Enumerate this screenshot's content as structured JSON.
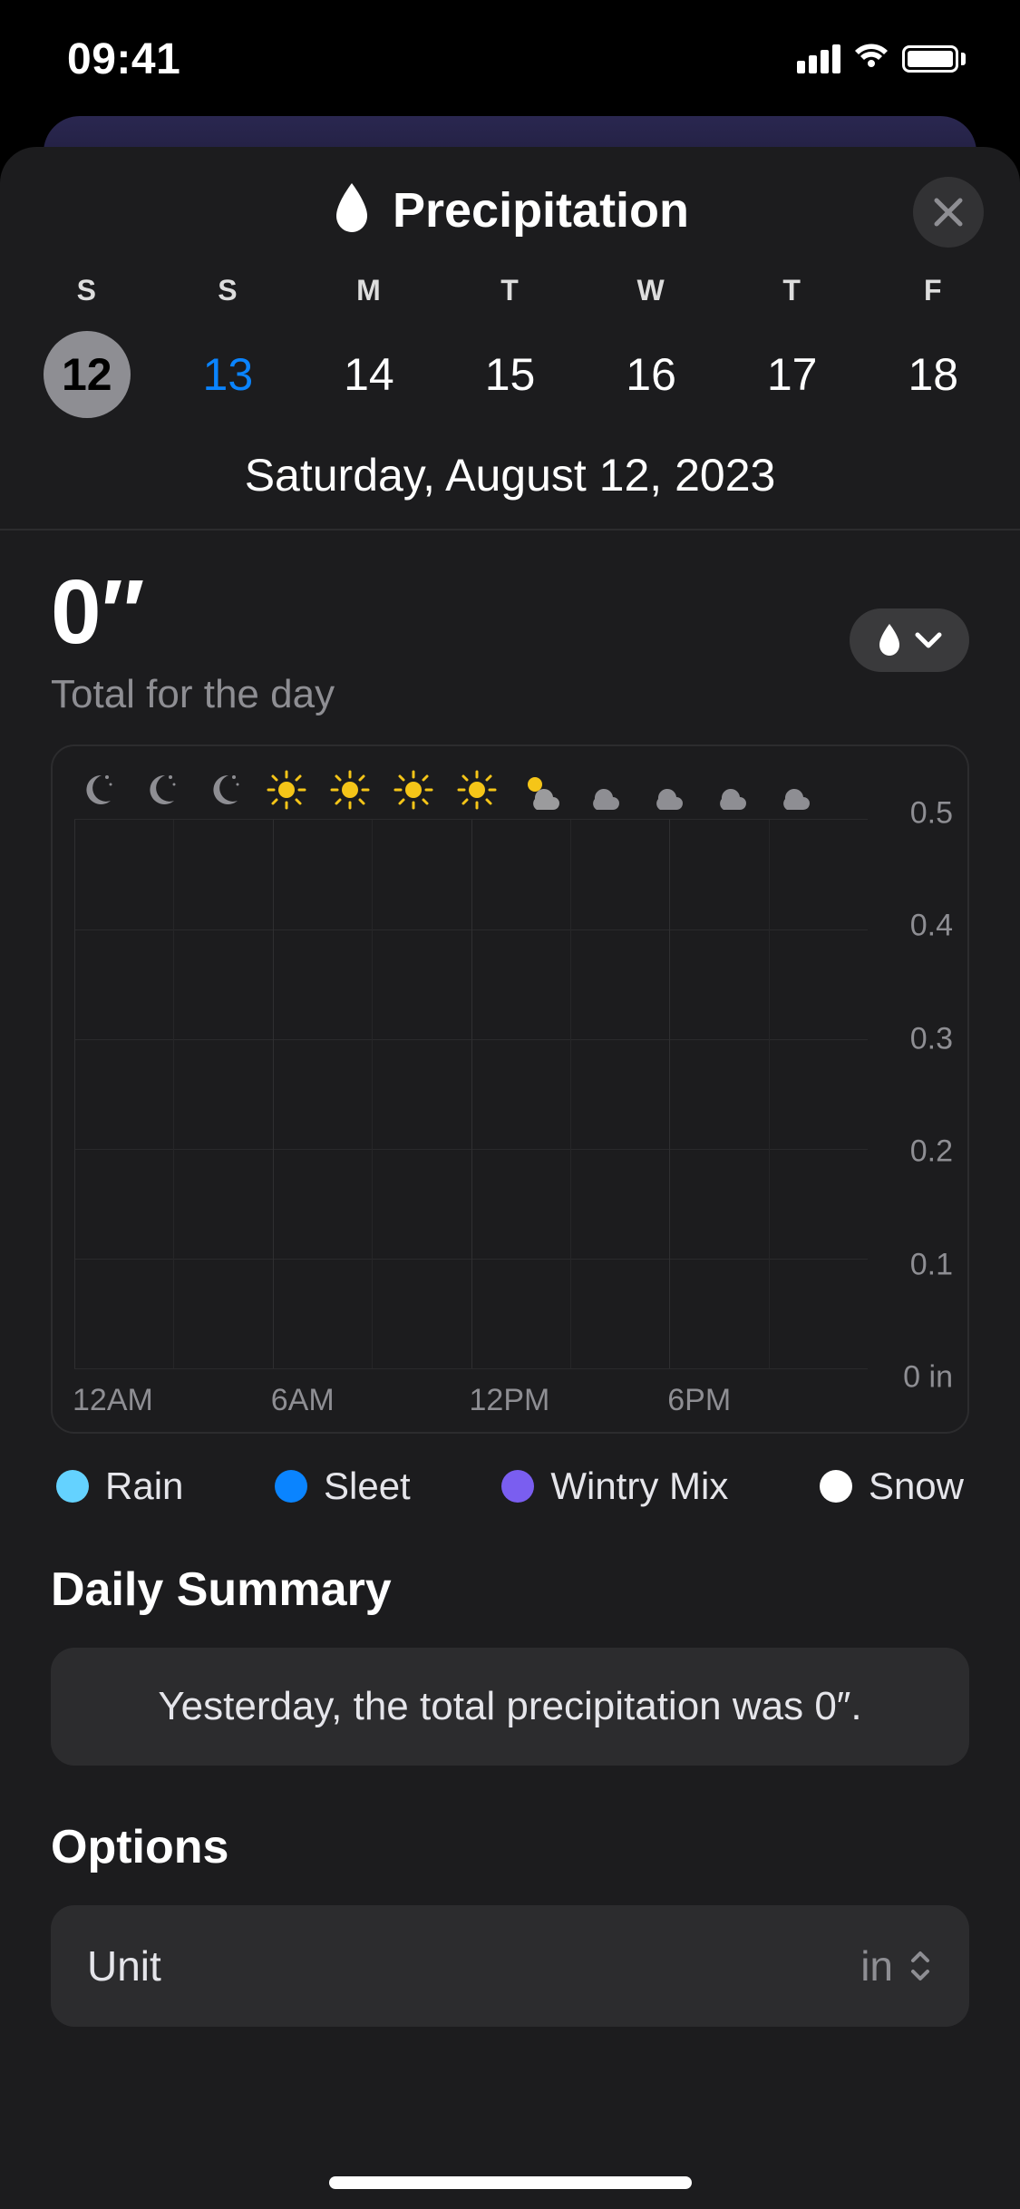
{
  "status": {
    "time": "09:41"
  },
  "header": {
    "title": "Precipitation"
  },
  "days": {
    "dows": [
      "S",
      "S",
      "M",
      "T",
      "W",
      "T",
      "F"
    ],
    "nums": [
      "12",
      "13",
      "14",
      "15",
      "16",
      "17",
      "18"
    ],
    "selected_index": 0,
    "today_index": 1,
    "full_date": "Saturday, August 12, 2023"
  },
  "total": {
    "value": "0″",
    "label": "Total for the day"
  },
  "legend": {
    "items": [
      {
        "label": "Rain",
        "color": "#64d2ff"
      },
      {
        "label": "Sleet",
        "color": "#0a84ff"
      },
      {
        "label": "Wintry Mix",
        "color": "#7a5ef0"
      },
      {
        "label": "Snow",
        "color": "#ffffff"
      }
    ]
  },
  "summary": {
    "title": "Daily Summary",
    "text": "Yesterday, the total precipitation was 0″."
  },
  "options": {
    "title": "Options",
    "unit_label": "Unit",
    "unit_value": "in"
  },
  "chart_data": {
    "type": "bar",
    "title": "Hourly precipitation",
    "x_hours": [
      0,
      1,
      2,
      3,
      4,
      5,
      6,
      7,
      8,
      9,
      10,
      11,
      12,
      13,
      14,
      15,
      16,
      17,
      18,
      19,
      20,
      21,
      22,
      23
    ],
    "series": [
      {
        "name": "Rain",
        "values": [
          0,
          0,
          0,
          0,
          0,
          0,
          0,
          0,
          0,
          0,
          0,
          0,
          0,
          0,
          0,
          0,
          0,
          0,
          0,
          0,
          0,
          0,
          0,
          0
        ]
      },
      {
        "name": "Sleet",
        "values": [
          0,
          0,
          0,
          0,
          0,
          0,
          0,
          0,
          0,
          0,
          0,
          0,
          0,
          0,
          0,
          0,
          0,
          0,
          0,
          0,
          0,
          0,
          0,
          0
        ]
      },
      {
        "name": "Wintry Mix",
        "values": [
          0,
          0,
          0,
          0,
          0,
          0,
          0,
          0,
          0,
          0,
          0,
          0,
          0,
          0,
          0,
          0,
          0,
          0,
          0,
          0,
          0,
          0,
          0,
          0
        ]
      },
      {
        "name": "Snow",
        "values": [
          0,
          0,
          0,
          0,
          0,
          0,
          0,
          0,
          0,
          0,
          0,
          0,
          0,
          0,
          0,
          0,
          0,
          0,
          0,
          0,
          0,
          0,
          0,
          0
        ]
      }
    ],
    "ylim": [
      0,
      0.5
    ],
    "yticks": [
      0,
      0.1,
      0.2,
      0.3,
      0.4,
      0.5
    ],
    "ytick_labels": [
      "0 in",
      "0.1",
      "0.2",
      "0.3",
      "0.4",
      "0.5"
    ],
    "xtick_labels": [
      "12AM",
      "6AM",
      "12PM",
      "6PM"
    ],
    "xtick_hours": [
      0,
      6,
      12,
      18
    ],
    "unit": "in",
    "conditions_row": [
      "clear-night",
      "clear-night",
      "clear-night",
      "sunny",
      "sunny",
      "sunny",
      "sunny",
      "partly-cloudy",
      "cloudy",
      "cloudy",
      "cloudy",
      "cloudy"
    ]
  }
}
